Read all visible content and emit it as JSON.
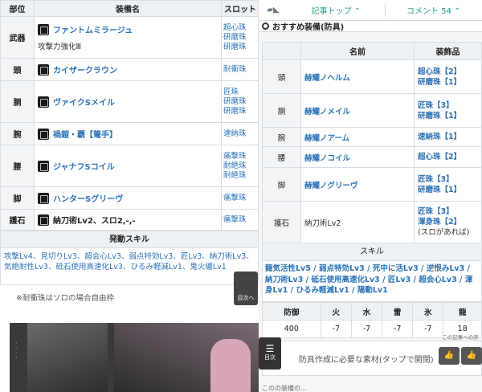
{
  "left": {
    "headers": [
      "部位",
      "装備名",
      "スロット"
    ],
    "rows": [
      {
        "part": "武器",
        "name": "ファントムミラージュ",
        "sub": "攻撃力強化Ⅲ",
        "slots": [
          "超心珠",
          "研磨珠",
          "研磨珠"
        ]
      },
      {
        "part": "頭",
        "name": "カイザークラウン",
        "sub": "",
        "slots": [
          "耐衝珠"
        ]
      },
      {
        "part": "胴",
        "name": "ヴァイクSメイル",
        "sub": "",
        "slots": [
          "匠珠",
          "研磨珠",
          "研磨珠"
        ]
      },
      {
        "part": "腕",
        "name": "禍鎧・覇【篭手】",
        "sub": "",
        "slots": [
          "速納珠"
        ]
      },
      {
        "part": "腰",
        "name": "ジャナフSコイル",
        "sub": "",
        "slots": [
          "痛撃珠",
          "耐絶珠",
          "耐絶珠"
        ]
      },
      {
        "part": "脚",
        "name": "ハンターSグリーヴ",
        "sub": "",
        "slots": [
          "痛撃珠"
        ]
      },
      {
        "part": "護石",
        "name": "納刀術Lv2、スロ2,-,-",
        "sub": "",
        "slots": [
          "痛撃珠"
        ]
      }
    ],
    "skill_header": "発動スキル",
    "skills_text": "攻撃Lv4、見切りLv3、超会心Lv3、弱点特効Lv3、匠Lv3、納刀術Lv3、気絶耐性Lv3、砥石使用高速化Lv3、ひるみ軽減Lv1、鬼火纏Lv1",
    "note": "※耐衝珠はソロの場合自由枠",
    "toc_label": "目次へ"
  },
  "right": {
    "topbar": {
      "top_label": "記事トップ",
      "top_icon": "⌃",
      "comment_label": "コメント 54",
      "comment_icon": "⌃"
    },
    "section_title": "おすすめ装備(防具)",
    "headers": [
      "",
      "名前",
      "装飾品"
    ],
    "rows": [
      {
        "part": "頭",
        "name": "赫耀ノヘルム",
        "decos": [
          "超心珠【2】",
          "研磨珠【1】"
        ]
      },
      {
        "part": "胴",
        "name": "赫耀ノメイル",
        "decos": [
          "匠珠【3】",
          "研磨珠【1】"
        ]
      },
      {
        "part": "腕",
        "name": "赫耀ノアーム",
        "decos": [
          "速納珠【1】"
        ]
      },
      {
        "part": "腰",
        "name": "赫耀ノコイル",
        "decos": [
          "超心珠【2】"
        ]
      },
      {
        "part": "脚",
        "name": "赫耀ノグリーヴ",
        "decos": [
          "匠珠【3】",
          "研磨珠【1】"
        ]
      },
      {
        "part": "護石",
        "name": "納刀術Lv2",
        "decos": [
          "匠珠【3】",
          "渾身珠【2】",
          "(スロがあれば)"
        ]
      }
    ],
    "skill_header": "スキル",
    "skills_text": "龍気活性Lv5 / 弱点特効Lv3 / 死中に活Lv3 / 逆恨みLv3 / 納刀術Lv3 / 砥石使用高速化Lv3 / 匠Lv3 / 超会心Lv3 / 渾身Lv1 / ひるみ軽減Lv1 / 陽動Lv1",
    "def_headers": [
      "防御",
      "火",
      "水",
      "雷",
      "氷",
      "龍"
    ],
    "def_values": [
      "400",
      "-7",
      "-7",
      "-7",
      "-7",
      "18"
    ],
    "materials_label": "防具作成に必要な素材(タップで開閉)",
    "materials_icon": "⌄",
    "toc_label": "目次",
    "comment_hint": "この記事への評",
    "like_icon": "👍",
    "bottom_hint": "このの装備の..."
  }
}
